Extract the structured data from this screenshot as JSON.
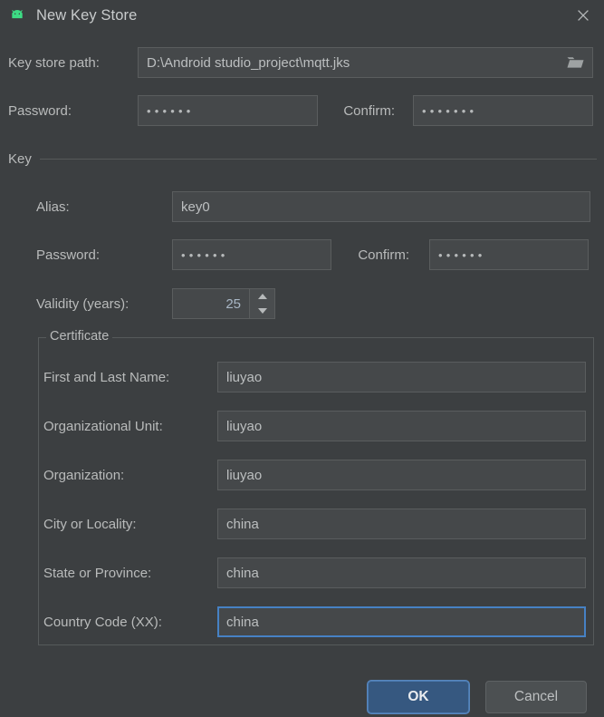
{
  "window": {
    "title": "New Key Store",
    "app_icon": "android-robot-icon",
    "close_icon": "close-icon",
    "accent_color": "#365880",
    "focus_color": "#4681c4",
    "background_color": "#3c3f41",
    "field_color": "#45484a",
    "android_green": "#3ddc84"
  },
  "keystore": {
    "path_label": "Key store path:",
    "path_value": "D:\\Android studio_project\\mqtt.jks",
    "browse_icon": "folder-icon",
    "password_label": "Password:",
    "password_value": "••••••",
    "password_length": 6,
    "confirm_label": "Confirm:",
    "confirm_value": "•••••••",
    "confirm_length": 7
  },
  "key_section": {
    "title": "Key",
    "alias_label": "Alias:",
    "alias_value": "key0",
    "password_label": "Password:",
    "password_value": "••••••",
    "password_length": 6,
    "confirm_label": "Confirm:",
    "confirm_value": "••••••",
    "confirm_length": 6,
    "validity_label": "Validity (years):",
    "validity_value": "25",
    "spinner_up_icon": "chevron-up-icon",
    "spinner_down_icon": "chevron-down-icon"
  },
  "certificate": {
    "title": "Certificate",
    "fields": [
      {
        "label": "First and Last Name:",
        "value": "liuyao",
        "focused": false
      },
      {
        "label": "Organizational Unit:",
        "value": "liuyao",
        "focused": false
      },
      {
        "label": "Organization:",
        "value": "liuyao",
        "focused": false
      },
      {
        "label": "City or Locality:",
        "value": "china",
        "focused": false
      },
      {
        "label": "State or Province:",
        "value": "china",
        "focused": false
      },
      {
        "label": "Country Code (XX):",
        "value": "china",
        "focused": true
      }
    ]
  },
  "footer": {
    "ok_label": "OK",
    "cancel_label": "Cancel"
  }
}
